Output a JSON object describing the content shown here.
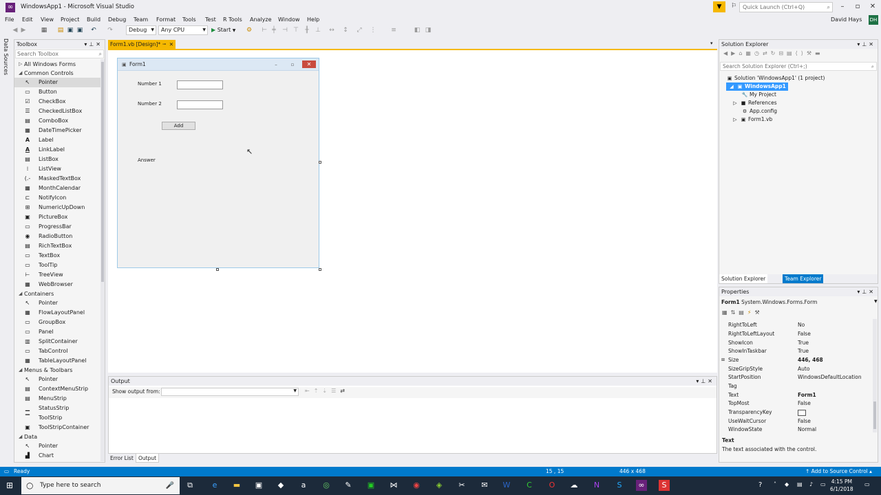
{
  "window": {
    "title": "WindowsApp1 - Microsoft Visual Studio",
    "quick_launch_placeholder": "Quick Launch (Ctrl+Q)",
    "user_name": "David Hays",
    "user_initials": "DH"
  },
  "menu": [
    "File",
    "Edit",
    "View",
    "Project",
    "Build",
    "Debug",
    "Team",
    "Format",
    "Tools",
    "Test",
    "R Tools",
    "Analyze",
    "Window",
    "Help"
  ],
  "toolbar": {
    "config": "Debug",
    "platform": "Any CPU",
    "start_label": "Start"
  },
  "data_sources_label": "Data Sources",
  "toolbox": {
    "title": "Toolbox",
    "search_placeholder": "Search Toolbox",
    "categories": {
      "all": "All Windows Forms",
      "common": "Common Controls",
      "containers": "Containers",
      "menus": "Menus & Toolbars",
      "data": "Data"
    },
    "common_items": [
      "Pointer",
      "Button",
      "CheckBox",
      "CheckedListBox",
      "ComboBox",
      "DateTimePicker",
      "Label",
      "LinkLabel",
      "ListBox",
      "ListView",
      "MaskedTextBox",
      "MonthCalendar",
      "NotifyIcon",
      "NumericUpDown",
      "PictureBox",
      "ProgressBar",
      "RadioButton",
      "RichTextBox",
      "TextBox",
      "ToolTip",
      "TreeView",
      "WebBrowser"
    ],
    "container_items": [
      "Pointer",
      "FlowLayoutPanel",
      "GroupBox",
      "Panel",
      "SplitContainer",
      "TabControl",
      "TableLayoutPanel"
    ],
    "menu_items": [
      "Pointer",
      "ContextMenuStrip",
      "MenuStrip",
      "StatusStrip",
      "ToolStrip",
      "ToolStripContainer"
    ],
    "data_items": [
      "Pointer",
      "Chart"
    ]
  },
  "document_tab": "Form1.vb [Design]*",
  "form": {
    "caption": "Form1",
    "label1": "Number 1",
    "label2": "Number 2",
    "button": "Add",
    "answer_label": "Answer"
  },
  "output": {
    "title": "Output",
    "show_output_from": "Show output from:",
    "bottom_tabs": [
      "Error List",
      "Output"
    ]
  },
  "solution_explorer": {
    "title": "Solution Explorer",
    "search_placeholder": "Search Solution Explorer (Ctrl+;)",
    "tree": [
      "Solution 'WindowsApp1' (1 project)",
      "WindowsApp1",
      "My Project",
      "References",
      "App.config",
      "Form1.vb"
    ],
    "tabs": [
      "Solution Explorer",
      "Team Explorer"
    ]
  },
  "properties": {
    "title": "Properties",
    "object_name": "Form1",
    "object_type": "System.Windows.Forms.Form",
    "rows": [
      {
        "name": "RightToLeft",
        "value": "No"
      },
      {
        "name": "RightToLeftLayout",
        "value": "False"
      },
      {
        "name": "ShowIcon",
        "value": "True"
      },
      {
        "name": "ShowInTaskbar",
        "value": "True"
      },
      {
        "name": "Size",
        "value": "446, 468"
      },
      {
        "name": "SizeGripStyle",
        "value": "Auto"
      },
      {
        "name": "StartPosition",
        "value": "WindowsDefaultLocation"
      },
      {
        "name": "Tag",
        "value": ""
      },
      {
        "name": "Text",
        "value": "Form1"
      },
      {
        "name": "TopMost",
        "value": "False"
      },
      {
        "name": "TransparencyKey",
        "value": ""
      },
      {
        "name": "UseWaitCursor",
        "value": "False"
      },
      {
        "name": "WindowState",
        "value": "Normal"
      }
    ],
    "desc_title": "Text",
    "desc": "The text associated with the control."
  },
  "status": {
    "ready": "Ready",
    "position": "15 , 15",
    "size": "446 x 468",
    "source_control": "Add to Source Control"
  },
  "taskbar": {
    "search_placeholder": "Type here to search",
    "time": "4:15 PM",
    "date": "6/1/2018"
  }
}
